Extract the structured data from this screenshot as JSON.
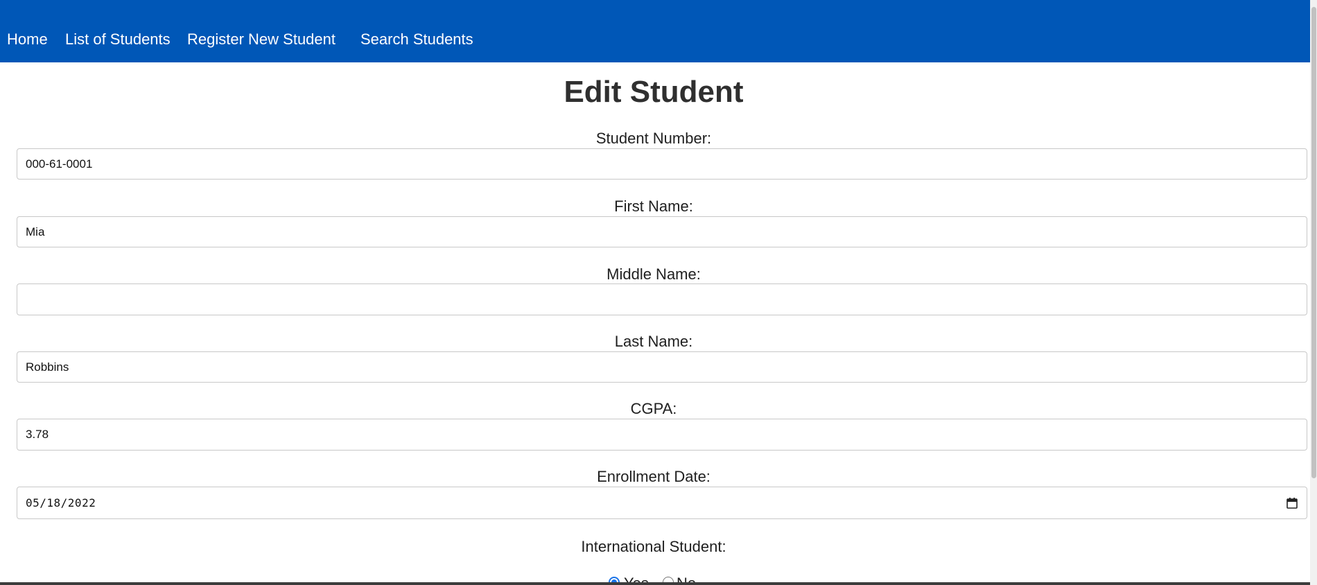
{
  "nav": {
    "home": "Home",
    "list_students": "List of Students",
    "register_student": "Register New Student",
    "search_students": "Search Students"
  },
  "page": {
    "title": "Edit Student"
  },
  "form": {
    "student_number": {
      "label": "Student Number:",
      "value": "000-61-0001"
    },
    "first_name": {
      "label": "First Name:",
      "value": "Mia"
    },
    "middle_name": {
      "label": "Middle Name:",
      "value": ""
    },
    "last_name": {
      "label": "Last Name:",
      "value": "Robbins"
    },
    "cgpa": {
      "label": "CGPA:",
      "value": "3.78"
    },
    "enrollment_date": {
      "label": "Enrollment Date:",
      "value": "05/18/2022"
    },
    "international": {
      "label": "International Student:",
      "options": [
        {
          "label": "Yes",
          "checked": true
        },
        {
          "label": "No",
          "checked": false
        }
      ]
    }
  },
  "icons": {
    "date_picker": "calendar-icon"
  },
  "colors": {
    "navbar_bg": "#0057b7",
    "radio_accent": "#1a73e8"
  }
}
